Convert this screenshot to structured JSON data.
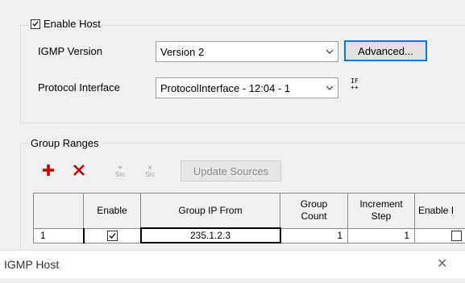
{
  "host_section": {
    "enable_label": "Enable Host",
    "enable_checked": true,
    "igmp_version_label": "IGMP Version",
    "igmp_version_value": "Version 2",
    "advanced_label": "Advanced...",
    "protocol_interface_label": "Protocol Interface",
    "protocol_interface_value": "ProtocolInterface - 12:04 - 1",
    "interface_icon_glyph": "IF\n++",
    "icons": {
      "enable_checkbox": "checkbox-checked-icon",
      "combo_arrow": "chevron-down-icon",
      "interface_icon": "interface-icon"
    }
  },
  "group_ranges": {
    "legend": "Group Ranges",
    "toolbar": {
      "add_icon": "plus-icon",
      "delete_icon": "x-icon",
      "add_src_label": "Src",
      "remove_src_label": "Src",
      "update_sources_label": "Update Sources",
      "add_color": "#c00000",
      "delete_color": "#c00000"
    },
    "columns": [
      "",
      "Enable",
      "Group IP From",
      "Group Count",
      "Increment Step",
      "Enable I"
    ],
    "rows": [
      {
        "index": "1",
        "enable": true,
        "group_ip_from": "235.1.2.3",
        "group_count": "1",
        "increment_step": "1",
        "enable_extra": false
      }
    ]
  },
  "window": {
    "title": "IGMP Host",
    "close_glyph": "✕"
  }
}
